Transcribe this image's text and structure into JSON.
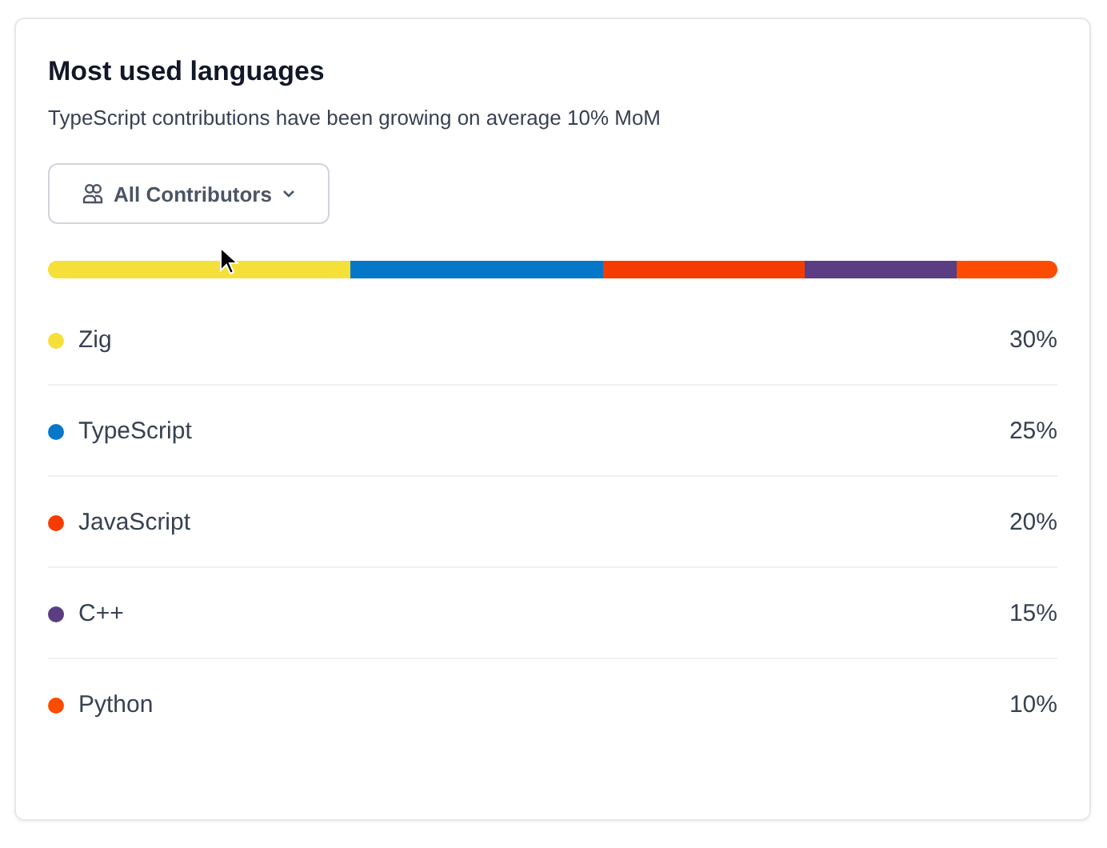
{
  "card": {
    "title": "Most used languages",
    "subtitle": "TypeScript contributions have been growing on average 10% MoM",
    "filter_button": {
      "label": "All Contributors"
    },
    "languages": [
      {
        "name": "Zig",
        "percent": "30%",
        "color": "#f5e03a"
      },
      {
        "name": "TypeScript",
        "percent": "25%",
        "color": "#0577c9"
      },
      {
        "name": "JavaScript",
        "percent": "20%",
        "color": "#f53c00"
      },
      {
        "name": "C++",
        "percent": "15%",
        "color": "#5a3d82"
      },
      {
        "name": "Python",
        "percent": "10%",
        "color": "#fc4c02"
      }
    ]
  }
}
